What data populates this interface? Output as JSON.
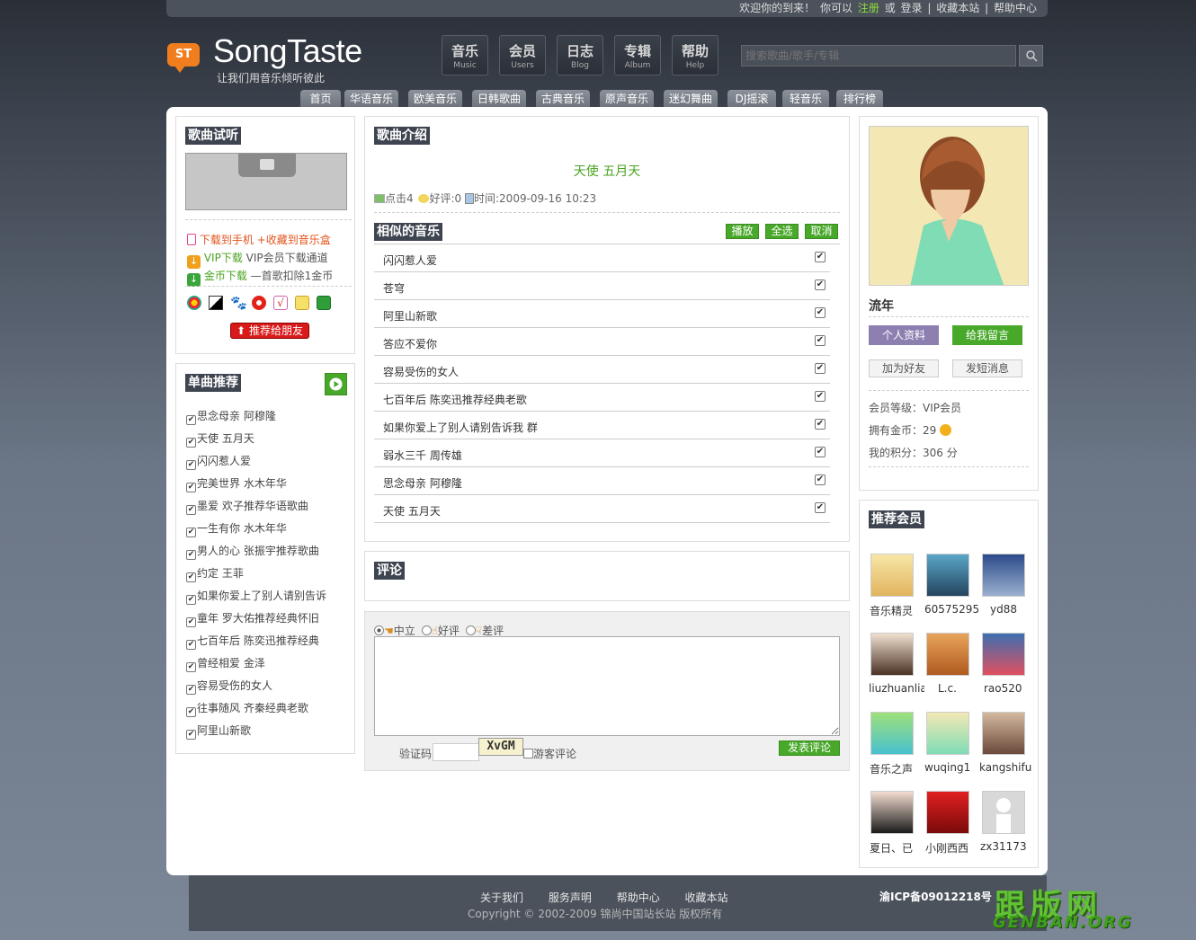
{
  "topbar": {
    "welcome": "欢迎你的到来！",
    "you_can": "你可以",
    "register": "注册",
    "or": "或",
    "login": "登录",
    "sep": "|",
    "bookmark": "收藏本站",
    "help": "帮助中心"
  },
  "brand": {
    "badge": "ST",
    "name": "SongTaste",
    "slogan": "让我们用音乐倾听彼此"
  },
  "nav": [
    {
      "cn": "音乐",
      "en": "Music"
    },
    {
      "cn": "会员",
      "en": "Users"
    },
    {
      "cn": "日志",
      "en": "Blog"
    },
    {
      "cn": "专辑",
      "en": "Album"
    },
    {
      "cn": "帮助",
      "en": "Help"
    }
  ],
  "search": {
    "placeholder": "搜索歌曲/歌手/专辑"
  },
  "channels": [
    "首页",
    "华语音乐",
    "欧美音乐",
    "日韩歌曲",
    "古典音乐",
    "原声音乐",
    "迷幻舞曲",
    "DJ摇滚",
    "轻音乐",
    "排行榜"
  ],
  "listen": {
    "title": "歌曲试听",
    "download_phone": "下载到手机",
    "add_box": "+收藏到音乐盒",
    "vip_label": "VIP下载",
    "vip_desc": "VIP会员下载通道",
    "gold_label": "金币下载",
    "gold_desc": "—首歌扣除1金币",
    "recommend_btn": "推荐给朋友"
  },
  "singles": {
    "title": "单曲推荐",
    "items": [
      "思念母亲 阿穆隆",
      "天使 五月天",
      "闪闪惹人爱",
      "完美世界 水木年华",
      "墨爱 欢子推荐华语歌曲",
      "一生有你 水木年华",
      "男人的心 张振宇推荐歌曲",
      "约定 王菲",
      "如果你爱上了别人请别告诉",
      "童年 罗大佑推荐经典怀旧",
      "七百年后 陈奕迅推荐经典",
      "曾经相爱 金泽",
      "容易受伤的女人",
      "往事随风 齐秦经典老歌",
      "阿里山新歌"
    ]
  },
  "intro": {
    "title": "歌曲介绍",
    "song_title": "天使 五月天",
    "clicks_label": "点击",
    "clicks": "4",
    "rating_label": "好评:",
    "rating": "0",
    "time_label": "时间:",
    "time": "2009-09-16 10:23"
  },
  "similar": {
    "title": "相似的音乐",
    "play": "播放",
    "select_all": "全选",
    "cancel": "取消",
    "songs": [
      "闪闪惹人爱",
      "苍穹",
      "阿里山新歌",
      "答应不爱你",
      "容易受伤的女人",
      "七百年后 陈奕迅推荐经典老歌",
      "如果你爱上了别人请别告诉我 群",
      "弱水三千 周传雄",
      "思念母亲 阿穆隆",
      "天使 五月天"
    ]
  },
  "comments": {
    "title": "评论"
  },
  "comment_form": {
    "neutral": "中立",
    "good": "好评",
    "bad": "差评",
    "captcha_label": "验证码",
    "captcha_code": "XvGM",
    "guest": "游客评论",
    "submit": "发表评论"
  },
  "profile": {
    "name": "流年",
    "profile_btn": "个人资料",
    "message_btn": "给我留言",
    "add_friend": "加为好友",
    "send_msg": "发短消息",
    "level_label": "会员等级：",
    "level": "VIP会员",
    "gold_label": "拥有金币：",
    "gold": "29",
    "points_label": "我的积分：",
    "points": "306 分"
  },
  "members": {
    "title": "推荐会员",
    "list": [
      "音乐精灵",
      "60575295",
      "yd88",
      "liuzhuanlia",
      "L.c.",
      "rao520",
      "音乐之声",
      "wuqing1",
      "kangshifu",
      "夏日、已",
      "小刚西西",
      "zx31173"
    ]
  },
  "footer": {
    "links": [
      "关于我们",
      "服务声明",
      "帮助中心",
      "收藏本站"
    ],
    "copyright": "Copyright © 2002-2009 锦尚中国站长站 版权所有",
    "icp": "渝ICP备09012218号"
  },
  "watermark": {
    "big": "跟版网",
    "small": "GENBAN.ORG"
  },
  "colors": {
    "accent_green": "#48a82a",
    "dark": "#3e4450",
    "purple_btn": "#8e7fb1"
  }
}
